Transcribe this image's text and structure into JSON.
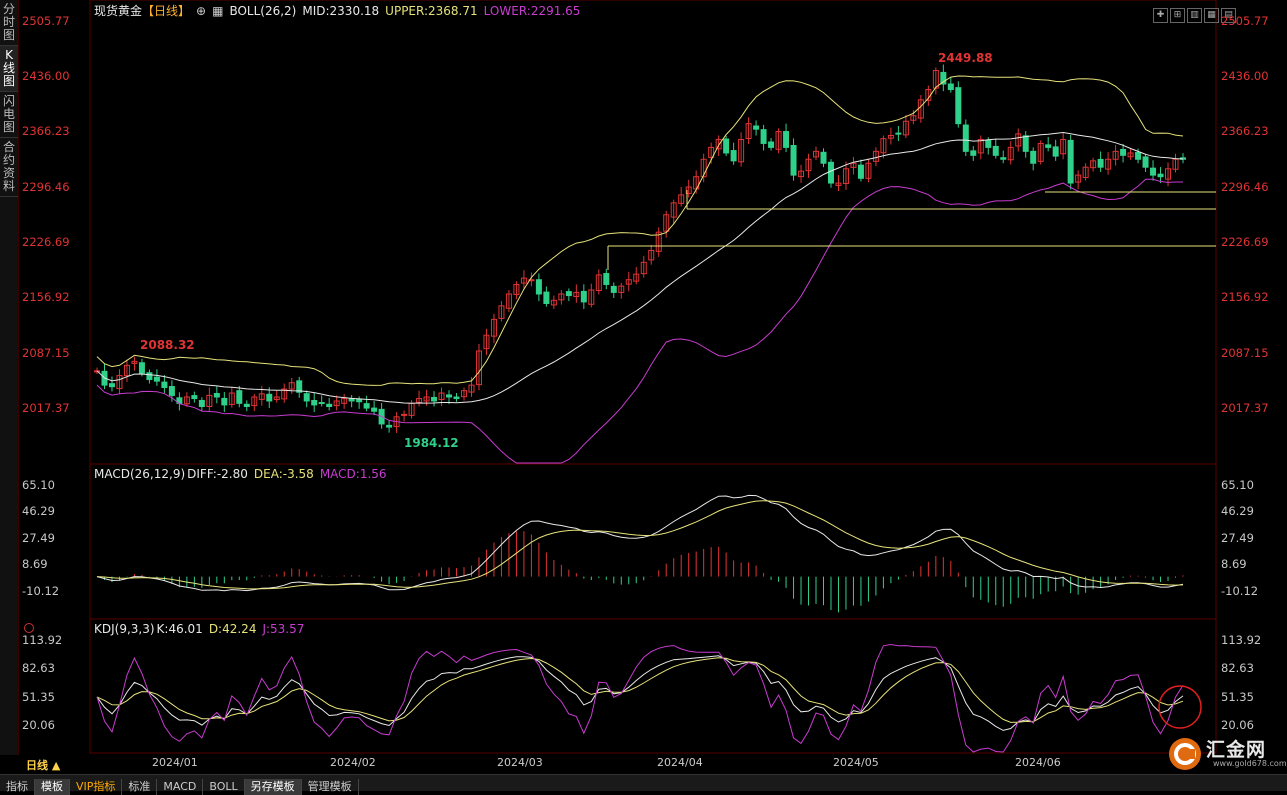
{
  "sidebar": {
    "tabs": [
      {
        "label": "分时图",
        "active": false
      },
      {
        "label": "K线图",
        "active": true
      },
      {
        "label": "闪电图",
        "active": false
      },
      {
        "label": "合约资料",
        "active": false
      }
    ]
  },
  "price_panel": {
    "title": "现货黄金",
    "period": "【日线】",
    "boll_name": "BOLL(26,2)",
    "mid": "MID:2330.18",
    "upper": "UPPER:2368.71",
    "lower": "LOWER:2291.65",
    "axis_ticks": [
      "2505.77",
      "2436.00",
      "2366.23",
      "2296.46",
      "2226.69",
      "2156.92",
      "2087.15",
      "2017.37"
    ],
    "high_label": "2449.88",
    "low_label": "1984.12",
    "prior_high_label": "2088.32"
  },
  "macd_panel": {
    "name": "MACD(26,12,9)",
    "diff": "DIFF:-2.80",
    "dea": "DEA:-3.58",
    "macd": "MACD:1.56",
    "axis_ticks": [
      "65.10",
      "46.29",
      "27.49",
      "8.69",
      "-10.12"
    ]
  },
  "kdj_panel": {
    "name": "KDJ(9,3,3)",
    "k": "K:46.01",
    "d": "D:42.24",
    "j": "J:53.57",
    "axis_ticks": [
      "113.92",
      "82.63",
      "51.35",
      "20.06"
    ]
  },
  "dates": [
    "2024/01",
    "2024/02",
    "2024/03",
    "2024/04",
    "2024/05",
    "2024/06"
  ],
  "period_badge": "日线 ▲",
  "bottom_tabs": [
    {
      "label": "指标",
      "active": false
    },
    {
      "label": "模板",
      "active": true
    },
    {
      "label": "VIP指标",
      "active": false,
      "vip": true
    },
    {
      "label": "标准",
      "active": false
    },
    {
      "label": "MACD",
      "active": false
    },
    {
      "label": "BOLL",
      "active": false
    },
    {
      "label": "另存模板",
      "active": true
    },
    {
      "label": "管理模板",
      "active": false
    }
  ],
  "watermark": {
    "brand": "汇金网",
    "url": "www.gold678.com"
  },
  "colors": {
    "up": "#e03434",
    "down": "#2fd08a",
    "upper": "#e6e27a",
    "mid": "#e8e8e8",
    "lower": "#c83cd0",
    "dea": "#e6e27a",
    "j": "#c83cd0"
  },
  "chart_data": {
    "type": "candlestick",
    "ylim": [
      1984.12,
      2505.77
    ],
    "start_close": 2063,
    "closes": [
      2063,
      2045,
      2043,
      2057,
      2070,
      2075,
      2060,
      2052,
      2050,
      2042,
      2032,
      2022,
      2030,
      2028,
      2018,
      2032,
      2030,
      2020,
      2035,
      2022,
      2018,
      2030,
      2034,
      2025,
      2030,
      2040,
      2048,
      2036,
      2025,
      2020,
      2022,
      2018,
      2025,
      2028,
      2025,
      2024,
      2016,
      2012,
      1996,
      1992,
      2005,
      2008,
      2022,
      2028,
      2030,
      2025,
      2035,
      2030,
      2028,
      2038,
      2045,
      2088,
      2108,
      2128,
      2145,
      2160,
      2172,
      2180,
      2178,
      2160,
      2148,
      2152,
      2160,
      2158,
      2162,
      2150,
      2165,
      2184,
      2172,
      2162,
      2170,
      2178,
      2185,
      2200,
      2215,
      2238,
      2260,
      2275,
      2285,
      2295,
      2308,
      2330,
      2345,
      2355,
      2338,
      2328,
      2355,
      2375,
      2368,
      2350,
      2345,
      2365,
      2345,
      2310,
      2315,
      2330,
      2340,
      2325,
      2300,
      2300,
      2318,
      2325,
      2306,
      2325,
      2340,
      2356,
      2360,
      2362,
      2378,
      2385,
      2405,
      2418,
      2442,
      2425,
      2418,
      2375,
      2340,
      2335,
      2355,
      2345,
      2335,
      2330,
      2345,
      2362,
      2340,
      2325,
      2350,
      2345,
      2334,
      2355,
      2300,
      2310,
      2320,
      2328,
      2320,
      2330,
      2340,
      2335,
      2338,
      2330,
      2320,
      2310,
      2308,
      2318,
      2330,
      2330
    ],
    "boll_upper_start": 2065,
    "boll_lower_start": 1955
  }
}
